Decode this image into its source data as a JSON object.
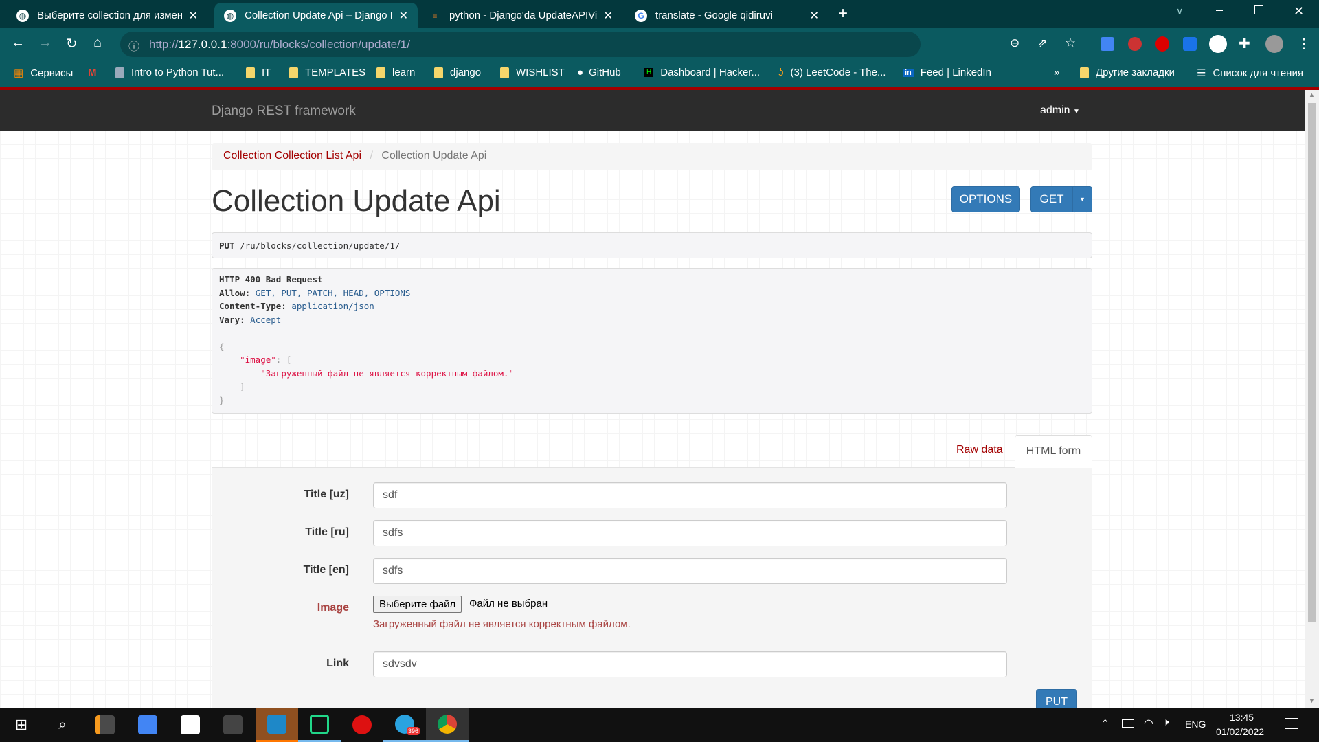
{
  "browser": {
    "tabs": [
      {
        "title": "Выберите collection для изменения",
        "active": false
      },
      {
        "title": "Collection Update Api – Django REST framework",
        "active": true
      },
      {
        "title": "python - Django'da UpdateAPIView",
        "active": false
      },
      {
        "title": "translate - Google qidiruvi",
        "active": false
      }
    ],
    "url_prefix": "http://",
    "url_host": "127.0.0.1",
    "url_rest": ":8000/ru/blocks/collection/update/1/",
    "bookmarks": [
      "Сервисы",
      "",
      "Intro to Python Tut...",
      "IT",
      "TEMPLATES",
      "learn",
      "django",
      "WISHLIST",
      "GitHub",
      "Dashboard | Hacker...",
      "(3) LeetCode - The...",
      "Feed | LinkedIn"
    ],
    "bookmarks_more": "»",
    "other_bookmarks": "Другие закладки",
    "reading_list": "Список для чтения"
  },
  "navbar": {
    "brand": "Django REST framework",
    "user": "admin"
  },
  "breadcrumb": {
    "items": [
      "Collection Collection List Api",
      "Collection Update Api"
    ],
    "separator": "/"
  },
  "page": {
    "title": "Collection Update Api",
    "options_label": "OPTIONS",
    "get_label": "GET"
  },
  "request": {
    "method": "PUT",
    "path": "/ru/blocks/collection/update/1/"
  },
  "response": {
    "status": "HTTP 400 Bad Request",
    "headers": [
      {
        "name": "Allow:",
        "value": "GET, PUT, PATCH, HEAD, OPTIONS"
      },
      {
        "name": "Content-Type:",
        "value": "application/json"
      },
      {
        "name": "Vary:",
        "value": "Accept"
      }
    ],
    "body": {
      "open": "{",
      "key": "\"image\"",
      "colon": ": ",
      "lbr": "[",
      "message": "\"Загруженный файл не является корректным файлом.\"",
      "rbr": "]",
      "close": "}"
    }
  },
  "form_tabs": {
    "raw": "Raw data",
    "html": "HTML form",
    "active": "HTML form"
  },
  "form": {
    "fields": [
      {
        "label": "Title [uz]",
        "value": "sdf"
      },
      {
        "label": "Title [ru]",
        "value": "sdfs"
      },
      {
        "label": "Title [en]",
        "value": "sdfs"
      }
    ],
    "image": {
      "label": "Image",
      "button": "Выберите файл",
      "status": "Файл не выбран",
      "error": "Загруженный файл не является корректным файлом."
    },
    "link": {
      "label": "Link",
      "value": "sdvsdv"
    },
    "submit": "PUT"
  },
  "taskbar": {
    "lang": "ENG",
    "time": "13:45",
    "date": "01/02/2022",
    "telegram_badge": "396"
  },
  "colors": {
    "brand_red": "#a30000",
    "primary": "#337ab7",
    "error": "#a94442",
    "browser": "#0b5a60"
  }
}
